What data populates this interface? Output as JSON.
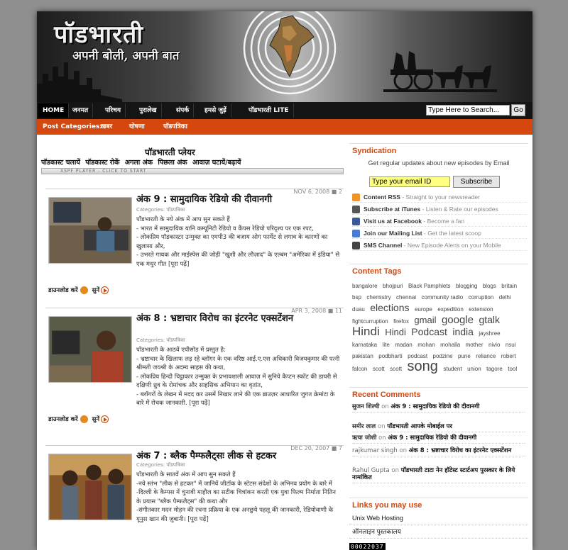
{
  "header": {
    "title": "पॉडभारती",
    "tagline": "अपनी बोली, अपनी बात"
  },
  "nav": {
    "items": [
      "HOME",
      "जनमत",
      "परिचय",
      "पुरालेख",
      "संपर्क",
      "हमसे जुड़ें",
      "पॉडभारती LITE"
    ],
    "search_value": "Type Here to Search...",
    "go_label": "Go"
  },
  "categories": {
    "label": "Post Categories:",
    "items": [
      "खबर",
      "घोषणा",
      "पॉडपत्रिका"
    ]
  },
  "player": {
    "title": "पॉडभारती प्लेयर",
    "controls": [
      "पॉडकास्ट चलायें",
      "पॉडकास्ट रोकें",
      "अगला अंक",
      "पिछला अंक",
      "आवाज़ घटायें/बढ़ायें"
    ],
    "bar_text": "XSPF PLAYER - CLICK TO START"
  },
  "posts": [
    {
      "date": "NOV 6, 2008",
      "comments": "2",
      "title": "अंक 9 : सामुदायिक रेडियो की दीवानगी",
      "category": "Categories: पॉडपत्रिका",
      "lines": [
        "पॉडभारती के नये अंक में आप सुन सकते हैं",
        "- भारत में सामुदायिक यानि कम्यूनिटी रेडियो व कैंपस रेडियो परिदृश्य पर एक रपट,",
        "- लोकप्रिय पॉडकास्टर उन्मुक्त का एमपी3 की बजाय ओग फार्मेट से लगाव के कारणों का खुलासा और,",
        "- उभरते गायक और माईस्पेस की जोड़ी \"खुशी और लौज़ाद\" के एल्बम \"अमेरिका में इंडिया\" से एक मधुर गीत [पूरा पढ़ें]"
      ],
      "download": "डाउनलोड करें",
      "listen": "सुनें"
    },
    {
      "date": "APR 3, 2008",
      "comments": "11",
      "title": "अंक 8 : भ्रष्टाचार विरोध का इंटरनेट एक्सटेंशन",
      "category": "Categories: पॉडपत्रिका",
      "lines": [
        "पॉडभारती के आठवें एपीसोड में प्रस्तुत है:",
        "- भ्रष्टाचार के खिलाफ लड़ रहे ब्लॉगर के एक वरिष्ठ आई.ए.एस अधिकारी विजयकुमार की पत्नी श्रीमती जयश्री के अदम्य साहस की कथा,",
        "- लोकप्रिय हिन्दी चिट्ठाकार उन्मुक्त के प्रभावशाली आवाज़ में सुनिये कैप्टन स्कॉट की डायरी से दक्षिणी ध्रुव के रोमांचक और साहसिक अभियान का वृतांत,",
        "- ब्लॉगरों के लेखन में मदद कर उसमें निखार लाने की एक ब्राउज़र आधारित जुगत क्रेमांटा के बारे में रोचक जानकारी. [पूरा पढ़ें]"
      ],
      "download": "डाउनलोड करें",
      "listen": "सुनें"
    },
    {
      "date": "DEC 20, 2007",
      "comments": "7",
      "title": "अंक 7 : ब्लैक पैम्फलैट्सः लीक से हटकर",
      "category": "Categories: पॉडपत्रिका",
      "lines": [
        "पॉडभारती के सातवें अंक में आप सुन सकते हैं",
        "-नये स्तंभ \"लीक से हटकर\" में जानियें जीटॉक के स्टेटस संदेशों के अभिनव प्रयोग के बारे में",
        "-दिल्ली के कैम्पस में चुनावी माहौल का सटीक चित्रांकन करती एक युवा फिल्म निर्माता नितिन के प्रयास \"ब्लैक पैम्फलैट्स\" की कथा और",
        "-संगीतकार मदन मोहन की रचना प्रक्रिया के एक अनछुये पहलू की जानकारी, रेडियोवाणी के यूनुस खान की ज़ुबानी। [पूरा पढ़ें]"
      ],
      "download": "डाउनलोड करें",
      "listen": "सुनें"
    }
  ],
  "sidebar": {
    "syndication": {
      "title": "Syndication",
      "intro": "Get regular updates about new episodes by Email",
      "email_placeholder": "Type  your email ID",
      "subscribe_label": "Subscribe",
      "rows": [
        {
          "label": "Content RSS",
          "desc": " - Straight to your newsreader",
          "icon": "rss-icon",
          "color": "#f29423"
        },
        {
          "label": "Subscribe at iTunes",
          "desc": " - Listen & Rate our episodes",
          "icon": "itunes-icon",
          "color": "#555555"
        },
        {
          "label": "Visit us at Facebook",
          "desc": " - Become a fan",
          "icon": "facebook-icon",
          "color": "#3b5998"
        },
        {
          "label": "Join our Mailing List",
          "desc": " - Get the latest scoop",
          "icon": "google-icon",
          "color": "#4a7bd0"
        },
        {
          "label": "SMS Channel",
          "desc": " - New Episode Alerts on your Mobile",
          "icon": "sms-icon",
          "color": "#444444"
        }
      ]
    },
    "tags": {
      "title": "Content Tags",
      "items": [
        {
          "t": "bangalore",
          "s": 8
        },
        {
          "t": "bhojpuri",
          "s": 8
        },
        {
          "t": "Black Pamphlets",
          "s": 8
        },
        {
          "t": "blogging",
          "s": 8
        },
        {
          "t": "blogs",
          "s": 8
        },
        {
          "t": "britain",
          "s": 8
        },
        {
          "t": "bsp",
          "s": 8
        },
        {
          "t": "chemistry",
          "s": 8
        },
        {
          "t": "chennai",
          "s": 8
        },
        {
          "t": "community radio",
          "s": 8
        },
        {
          "t": "corruption",
          "s": 8
        },
        {
          "t": "delhi",
          "s": 8
        },
        {
          "t": "duau",
          "s": 8
        },
        {
          "t": "elections",
          "s": 14
        },
        {
          "t": "europe",
          "s": 8
        },
        {
          "t": "expedition",
          "s": 8
        },
        {
          "t": "extension",
          "s": 8
        },
        {
          "t": "fightcurruption",
          "s": 8
        },
        {
          "t": "firefox",
          "s": 8
        },
        {
          "t": "gmail",
          "s": 13
        },
        {
          "t": "google",
          "s": 15
        },
        {
          "t": "gtalk",
          "s": 14
        },
        {
          "t": "Hindi",
          "s": 17
        },
        {
          "t": "Hindi",
          "s": 13
        },
        {
          "t": "Podcast",
          "s": 14
        },
        {
          "t": "india",
          "s": 14
        },
        {
          "t": "jayshree",
          "s": 8
        },
        {
          "t": "karnataka",
          "s": 8
        },
        {
          "t": "lite",
          "s": 8
        },
        {
          "t": "madan",
          "s": 8
        },
        {
          "t": "mohan",
          "s": 8
        },
        {
          "t": "mohalla",
          "s": 8
        },
        {
          "t": "mother",
          "s": 8
        },
        {
          "t": "nivio",
          "s": 8
        },
        {
          "t": "nsui",
          "s": 8
        },
        {
          "t": "pakistan",
          "s": 8
        },
        {
          "t": "podbharti",
          "s": 8
        },
        {
          "t": "podcast",
          "s": 8
        },
        {
          "t": "podzine",
          "s": 8
        },
        {
          "t": "pune",
          "s": 8
        },
        {
          "t": "reliance",
          "s": 8
        },
        {
          "t": "robert",
          "s": 8
        },
        {
          "t": "falcon",
          "s": 8
        },
        {
          "t": "scott",
          "s": 8
        },
        {
          "t": "scott",
          "s": 8
        },
        {
          "t": "song",
          "s": 20
        },
        {
          "t": "student",
          "s": 8
        },
        {
          "t": "union",
          "s": 8
        },
        {
          "t": "tagore",
          "s": 8
        },
        {
          "t": "tool",
          "s": 8
        }
      ]
    },
    "comments": {
      "title": "Recent Comments",
      "items": [
        {
          "author": "सुजन शिल्पी",
          "on": "on",
          "post": "अंक 9 : सामुदायिक रेडियो की दीवानगी"
        },
        {
          "author": "समीर लाल",
          "on": "on",
          "post": "पॉडभारती आपके मोबाईल पर"
        },
        {
          "author": "ऋचा जोशी",
          "on": "on",
          "post": "अंक 9 : सामुदायिक रेडियो की दीवानगी"
        },
        {
          "author": "rajkumar singh",
          "on": "on",
          "post": "अंक 8 : भ्रष्टाचार विरोध का इंटरनेट एक्सटेंशन"
        },
        {
          "author": "Rahul Gupta",
          "on": "on",
          "post": "पॉडभारती टाटा नेन हॉटेस्ट स्टार्टअप पुरस्कार के लिये नामांकित"
        }
      ]
    },
    "links": {
      "title": "Links you may use",
      "items": [
        "Unix Web Hosting",
        "ऑनलाइन पुस्तकालय"
      ]
    },
    "counter": "00022037"
  }
}
